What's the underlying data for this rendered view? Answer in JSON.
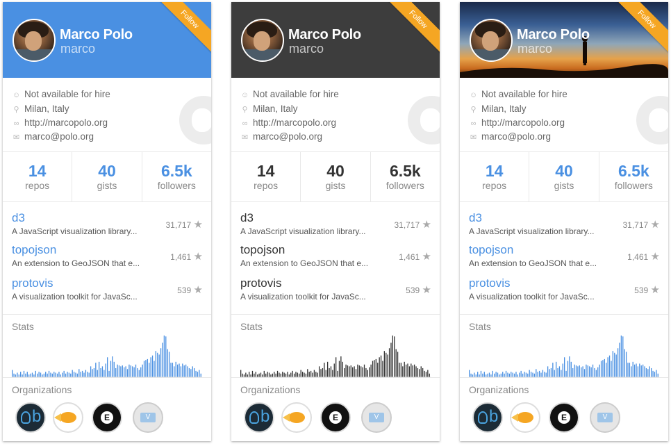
{
  "cards": [
    {
      "theme": "blue",
      "follow": "Follow",
      "name": "Marco Polo",
      "login": "marco",
      "hire": "Not available for hire",
      "location": "Milan, Italy",
      "blog": "http://marcopolo.org",
      "email": "marco@polo.org",
      "stats": [
        {
          "value": "14",
          "label": "repos"
        },
        {
          "value": "40",
          "label": "gists"
        },
        {
          "value": "6.5k",
          "label": "followers"
        }
      ],
      "repos": [
        {
          "name": "d3",
          "desc": "A JavaScript visualization library...",
          "stars": "31,717"
        },
        {
          "name": "topojson",
          "desc": "An extension to GeoJSON that e...",
          "stars": "1,461"
        },
        {
          "name": "protovis",
          "desc": "A visualization toolkit for JavaSc...",
          "stars": "539"
        }
      ],
      "stats_title": "Stats",
      "orgs_title": "Organizations",
      "bar_color": "#4a90e2"
    },
    {
      "theme": "dark",
      "follow": "Follow",
      "name": "Marco Polo",
      "login": "marco",
      "hire": "Not available for hire",
      "location": "Milan, Italy",
      "blog": "http://marcopolo.org",
      "email": "marco@polo.org",
      "stats": [
        {
          "value": "14",
          "label": "repos"
        },
        {
          "value": "40",
          "label": "gists"
        },
        {
          "value": "6.5k",
          "label": "followers"
        }
      ],
      "repos": [
        {
          "name": "d3",
          "desc": "A JavaScript visualization library...",
          "stars": "31,717"
        },
        {
          "name": "topojson",
          "desc": "An extension to GeoJSON that e...",
          "stars": "1,461"
        },
        {
          "name": "protovis",
          "desc": "A visualization toolkit for JavaSc...",
          "stars": "539"
        }
      ],
      "stats_title": "Stats",
      "orgs_title": "Organizations",
      "bar_color": "#333333"
    },
    {
      "theme": "photo",
      "follow": "Follow",
      "name": "Marco Polo",
      "login": "marco",
      "hire": "Not available for hire",
      "location": "Milan, Italy",
      "blog": "http://marcopolo.org",
      "email": "marco@polo.org",
      "stats": [
        {
          "value": "14",
          "label": "repos"
        },
        {
          "value": "40",
          "label": "gists"
        },
        {
          "value": "6.5k",
          "label": "followers"
        }
      ],
      "repos": [
        {
          "name": "d3",
          "desc": "A JavaScript visualization library...",
          "stars": "31,717"
        },
        {
          "name": "topojson",
          "desc": "An extension to GeoJSON that e...",
          "stars": "1,461"
        },
        {
          "name": "protovis",
          "desc": "A visualization toolkit for JavaSc...",
          "stars": "539"
        }
      ],
      "stats_title": "Stats",
      "orgs_title": "Organizations",
      "bar_color": "#4a90e2"
    }
  ],
  "icons": {
    "hire": "user-icon",
    "location": "map-pin-icon",
    "blog": "link-icon",
    "email": "envelope-icon",
    "star": "star-icon"
  },
  "chart_data": {
    "type": "bar",
    "values": [
      8,
      4,
      3,
      5,
      3,
      6,
      3,
      7,
      4,
      6,
      3,
      4,
      5,
      3,
      7,
      4,
      6,
      5,
      3,
      4,
      6,
      4,
      7,
      5,
      4,
      6,
      5,
      4,
      6,
      3,
      5,
      7,
      4,
      6,
      5,
      4,
      8,
      6,
      5,
      4,
      9,
      6,
      7,
      5,
      8,
      6,
      5,
      12,
      9,
      10,
      16,
      8,
      17,
      10,
      12,
      8,
      15,
      22,
      7,
      18,
      23,
      17,
      10,
      14,
      13,
      12,
      13,
      11,
      12,
      9,
      14,
      13,
      12,
      11,
      14,
      10,
      8,
      11,
      14,
      18,
      19,
      20,
      16,
      22,
      24,
      18,
      29,
      27,
      25,
      32,
      38,
      46,
      45,
      31,
      28,
      16,
      16,
      12,
      17,
      14,
      15,
      12,
      15,
      13,
      14,
      12,
      10,
      9,
      12,
      10,
      7,
      6,
      8,
      4
    ]
  }
}
